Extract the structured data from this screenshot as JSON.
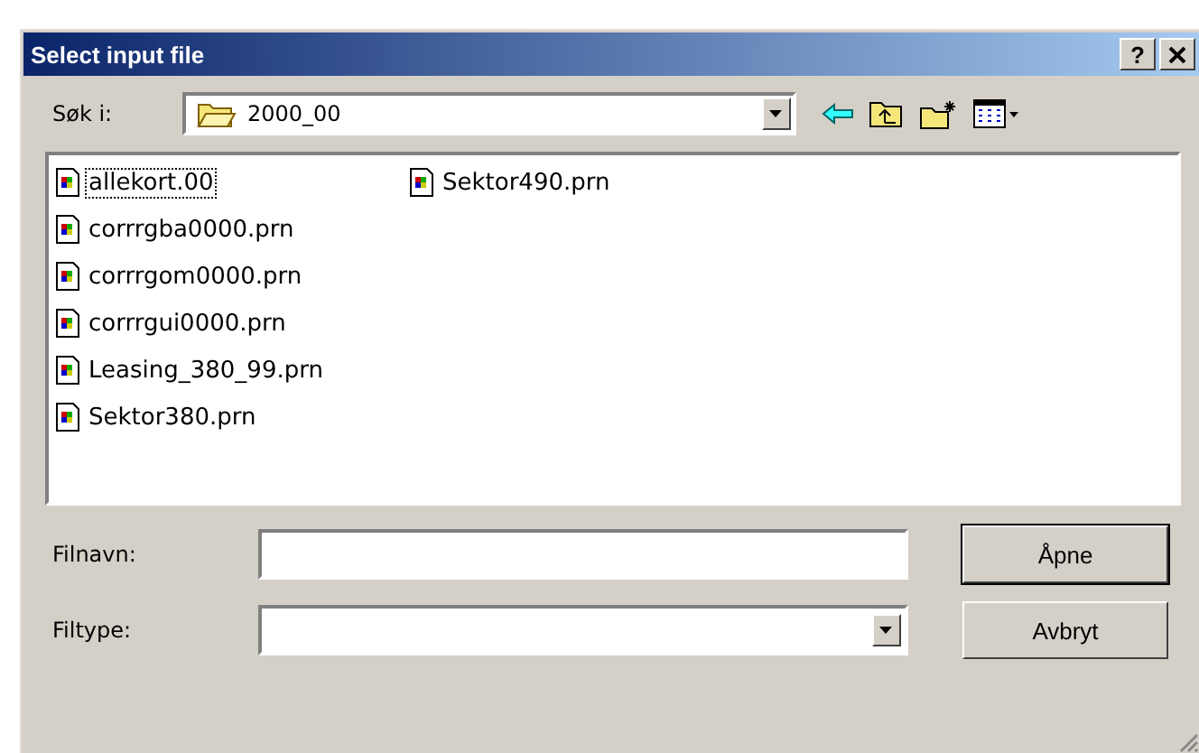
{
  "window": {
    "title": "Select input file",
    "help": "?"
  },
  "look_in": {
    "label": "Søk i:",
    "value": "2000_00"
  },
  "files": [
    {
      "name": "allekort.00",
      "selected": true
    },
    {
      "name": "corrrgba0000.prn",
      "selected": false
    },
    {
      "name": "corrrgom0000.prn",
      "selected": false
    },
    {
      "name": "corrrgui0000.prn",
      "selected": false
    },
    {
      "name": "Leasing_380_99.prn",
      "selected": false
    },
    {
      "name": "Sektor380.prn",
      "selected": false
    },
    {
      "name": "Sektor490.prn",
      "selected": false
    }
  ],
  "file_name": {
    "label": "Filnavn:"
  },
  "file_type": {
    "label": "Filtype:"
  },
  "buttons": [
    {
      "label": "Åpne",
      "default": true
    },
    {
      "label": "Avbryt",
      "default": false
    }
  ]
}
